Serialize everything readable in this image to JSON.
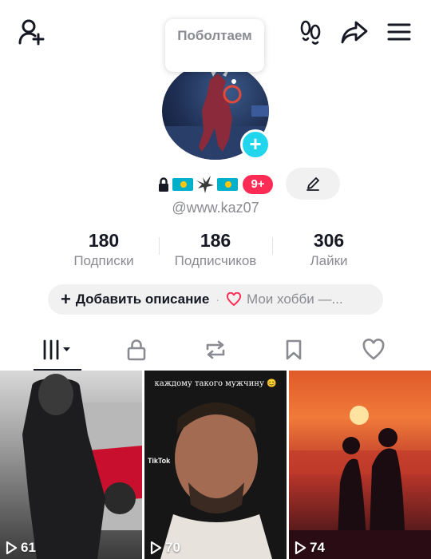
{
  "header": {
    "add_friend_icon": "person-plus-icon",
    "footprints_icon": "footprints-icon",
    "share_icon": "share-arrow-icon",
    "menu_icon": "hamburger-menu-icon"
  },
  "bubble": {
    "text": "Поболтаем"
  },
  "profile": {
    "avatar_icon": "profile-avatar",
    "add_photo_label": "+",
    "username": "@www.kaz07",
    "notification_count": "9+",
    "lock_icon": "lock-icon",
    "flag_icon": "kazakhstan-flag-icon",
    "eagle_icon": "eagle-icon",
    "edit_icon": "pencil-icon"
  },
  "stats": [
    {
      "value": "180",
      "label": "Подписки"
    },
    {
      "value": "186",
      "label": "Подписчиков"
    },
    {
      "value": "306",
      "label": "Лайки"
    }
  ],
  "bio": {
    "add_label": "Добавить описание",
    "separator": "·",
    "hobbies_label": "Мои хобби —..."
  },
  "tabs": [
    {
      "name": "videos",
      "icon": "grid-icon",
      "active": true
    },
    {
      "name": "private",
      "icon": "lock-icon",
      "active": false
    },
    {
      "name": "reposts",
      "icon": "repost-icon",
      "active": false
    },
    {
      "name": "favorites",
      "icon": "bookmark-icon",
      "active": false
    },
    {
      "name": "liked",
      "icon": "heart-icon",
      "active": false
    }
  ],
  "videos": [
    {
      "views": "61"
    },
    {
      "views": "70",
      "caption": "каждому такого мужчину 😊",
      "watermark": "TikTok"
    },
    {
      "views": "74"
    }
  ],
  "colors": {
    "accent": "#fe2c55",
    "avatar_plus": "#20d5ec",
    "secondary_text": "#8a8b91",
    "pill_bg": "#f1f1f2"
  }
}
